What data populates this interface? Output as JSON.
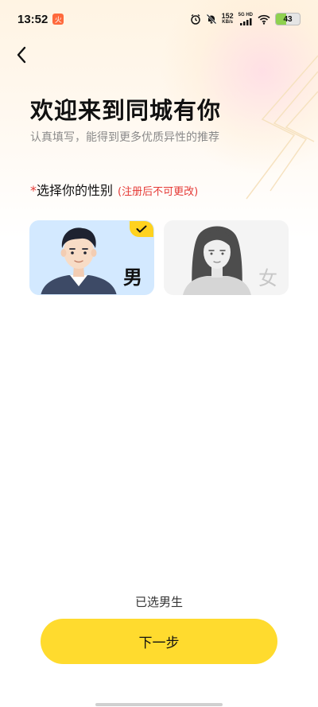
{
  "status_bar": {
    "time": "13:52",
    "notification_badge": "火",
    "net_speed_value": "152",
    "net_speed_unit": "KB/s",
    "signal_label": "5G HD",
    "battery": "43",
    "battery_level": 0.43
  },
  "header": {
    "title": "欢迎来到同城有你",
    "subtitle": "认真填写，能得到更多优质异性的推荐"
  },
  "gender_section": {
    "required_mark": "*",
    "label": "选择你的性别",
    "note": "(注册后不可更改)",
    "options": [
      {
        "label": "男",
        "selected": true
      },
      {
        "label": "女",
        "selected": false
      }
    ]
  },
  "footer": {
    "selected_text": "已选男生",
    "next_button": "下一步"
  },
  "colors": {
    "accent": "#ffdb2e",
    "check_tab": "#ffd21f",
    "male_card": "#d3e9ff",
    "female_card": "#f4f4f4",
    "warning": "#e53935"
  }
}
